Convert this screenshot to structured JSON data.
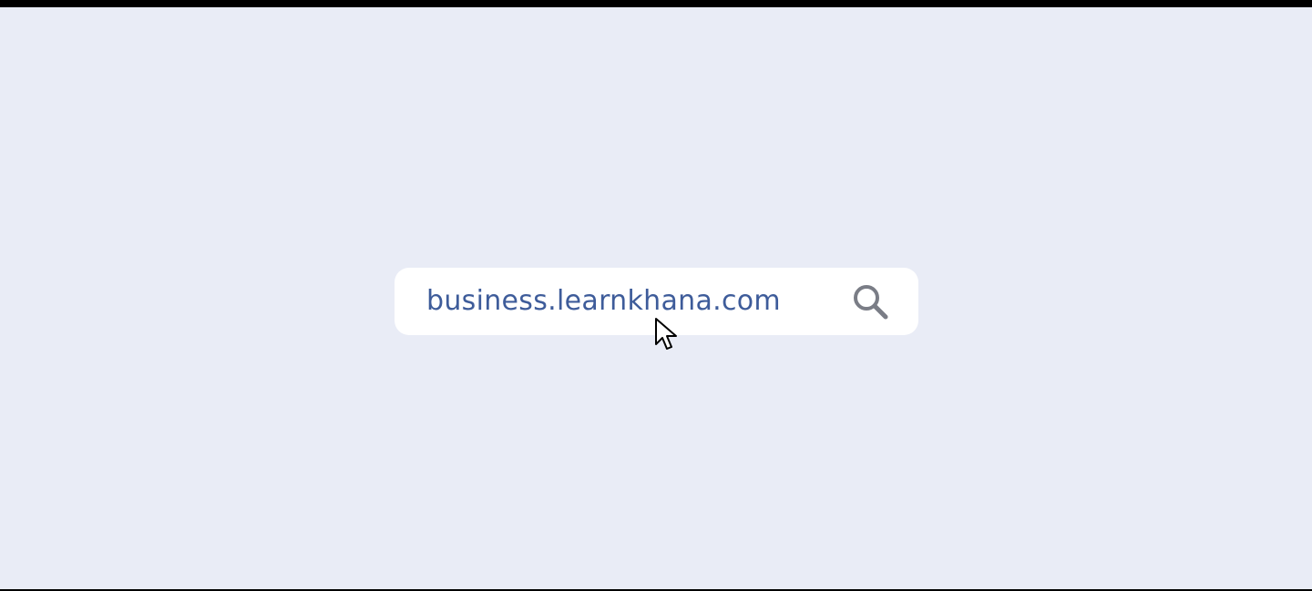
{
  "search": {
    "value": "business.learnkhana.com",
    "icon": "search-icon"
  },
  "pointer": {
    "icon": "mouse-cursor-icon"
  },
  "colors": {
    "background": "#e9ecf6",
    "search_box": "#ffffff",
    "text": "#3e5c9a",
    "icon": "#7a7d86"
  }
}
